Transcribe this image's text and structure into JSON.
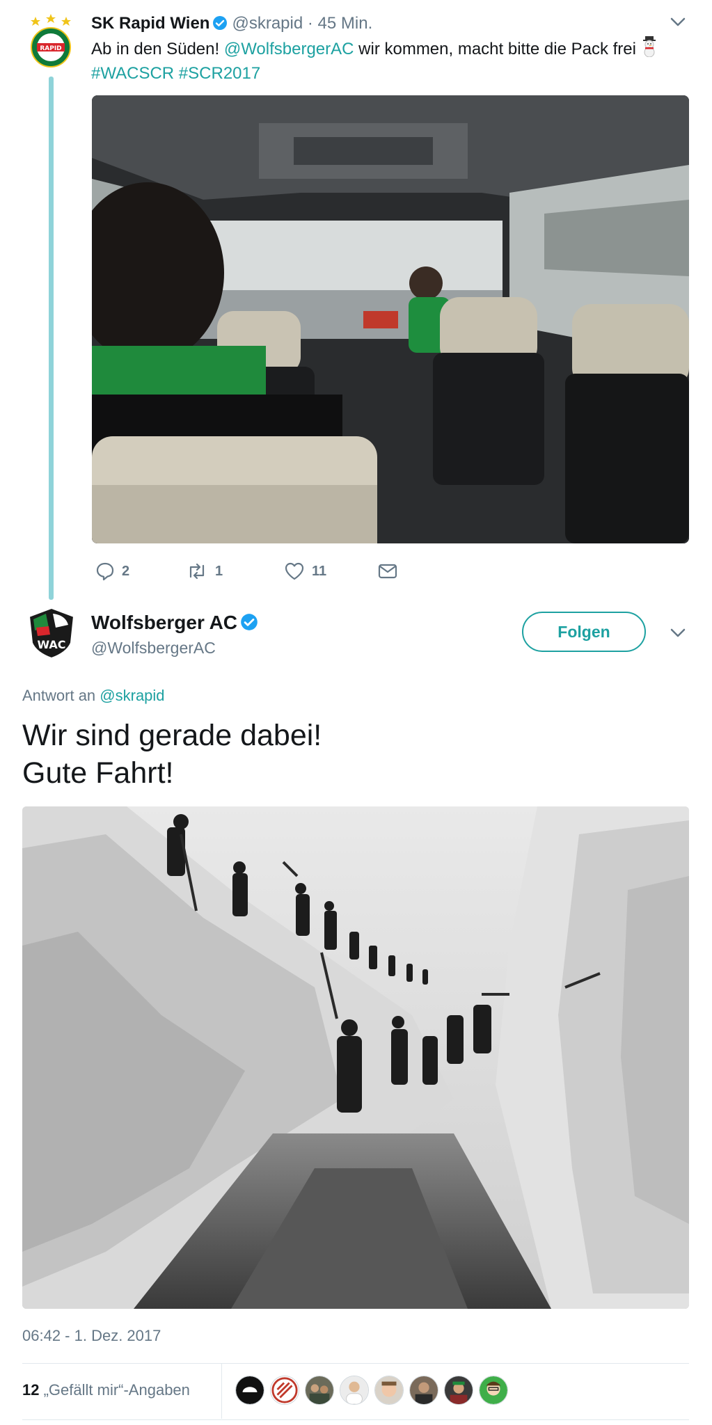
{
  "tweet1": {
    "author_name": "SK Rapid Wien",
    "author_handle": "@skrapid",
    "separator": "·",
    "time_ago": "45 Min.",
    "text_before": "Ab in den Süden! ",
    "mention": "@WolfsbergerAC",
    "text_after": " wir kommen, macht bitte die Pack frei",
    "hashtags": [
      "#WACSCR",
      "#SCR2017"
    ],
    "emoji": "snowman-icon",
    "actions": {
      "replies": "2",
      "retweets": "1",
      "likes": "11"
    }
  },
  "tweet2": {
    "author_name": "Wolfsberger AC",
    "author_handle": "@WolfsbergerAC",
    "follow_label": "Folgen",
    "reply_prefix": "Antwort an ",
    "reply_handle": "@skrapid",
    "text_line1": "Wir sind gerade dabei!",
    "text_line2": "Gute Fahrt!",
    "timestamp": "06:42 - 1. Dez. 2017",
    "likes_count": "12",
    "likes_label": " „Gefällt mir“-Angaben",
    "liker_avatars": 8
  },
  "colors": {
    "accent": "#1da1a1",
    "muted": "#657786",
    "verified": "#1da1f2",
    "thread_line": "#8fd3d9"
  }
}
